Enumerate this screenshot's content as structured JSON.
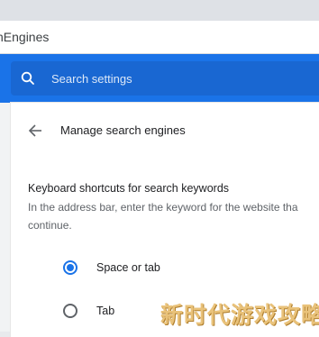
{
  "browser": {
    "url_fragment": "hEngines"
  },
  "header": {
    "search_placeholder": "Search settings",
    "accent_color": "#1a73e8"
  },
  "page": {
    "title": "Manage search engines",
    "back_icon": "arrow-left-icon"
  },
  "keyboard_shortcuts": {
    "title": "Keyboard shortcuts for search keywords",
    "description": "In the address bar, enter the keyword for the website tha continue.",
    "options": [
      {
        "label": "Space or tab",
        "selected": true
      },
      {
        "label": "Tab",
        "selected": false
      }
    ]
  },
  "watermark": {
    "text": "新时代游戏攻略"
  }
}
